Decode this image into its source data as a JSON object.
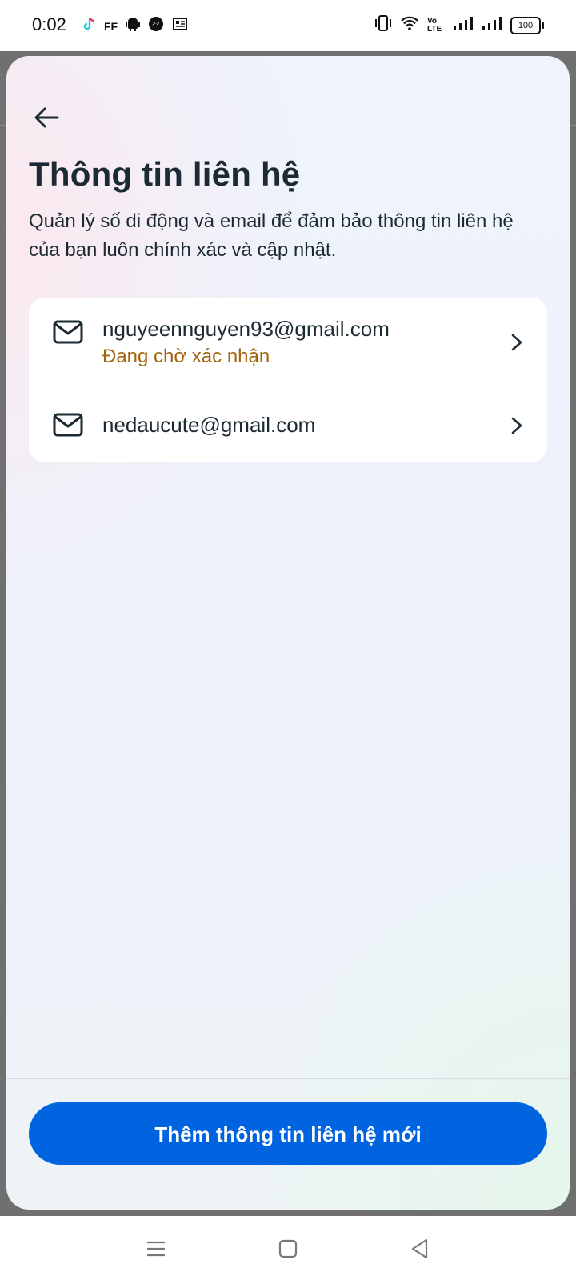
{
  "status_bar": {
    "time": "0:02",
    "left_icons": [
      "tiktok-icon",
      "ff-icon",
      "android-icon",
      "messenger-icon",
      "news-icon"
    ],
    "ff_label": "FF",
    "volte_label": "Vo LTE",
    "battery": "100"
  },
  "sheet": {
    "title": "Thông tin liên hệ",
    "subtitle": "Quản lý số di động và email để đảm bảo thông tin liên hệ của bạn luôn chính xác và cập nhật.",
    "contacts": [
      {
        "email": "nguyeennguyen93@gmail.com",
        "status": "Đang chờ xác nhận",
        "icon": "mail-icon"
      },
      {
        "email": "nedaucute@gmail.com",
        "icon": "mail-icon"
      }
    ],
    "add_button_label": "Thêm thông tin liên hệ mới"
  },
  "colors": {
    "primary": "#0064e0",
    "pending": "#a4630a",
    "text": "#1c2b33"
  }
}
